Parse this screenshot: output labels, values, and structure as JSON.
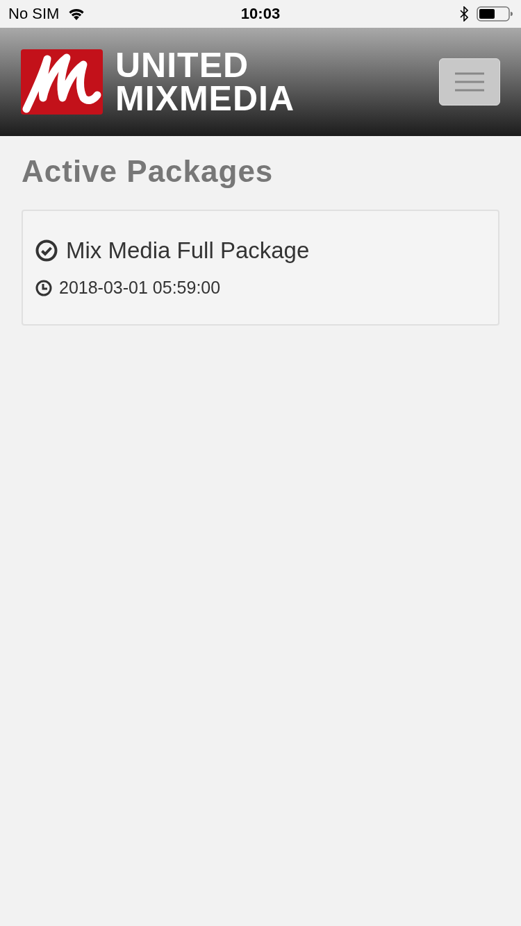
{
  "status_bar": {
    "carrier": "No SIM",
    "time": "10:03"
  },
  "header": {
    "logo_lines": [
      "UNITED",
      "MIXMEDIA"
    ]
  },
  "page_title": "Active Packages",
  "packages": [
    {
      "name": "Mix Media Full Package",
      "date": "2018-03-01 05:59:00"
    }
  ]
}
